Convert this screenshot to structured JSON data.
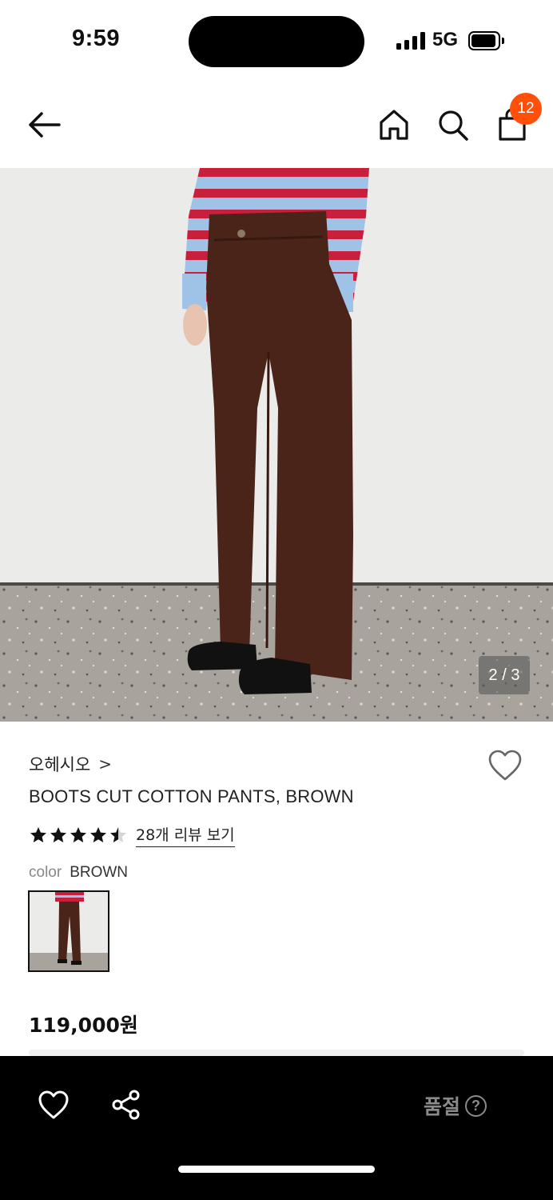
{
  "status_bar": {
    "time": "9:59",
    "network": "5G",
    "icons": [
      "signal-icon",
      "battery-icon"
    ]
  },
  "nav": {
    "icons": [
      "back-arrow-icon",
      "home-icon",
      "search-icon",
      "shopping-bag-icon"
    ],
    "cart_count": "12"
  },
  "gallery": {
    "counter": "2 / 3",
    "current": 2,
    "total": 3
  },
  "product": {
    "brand": "오헤시오",
    "brand_chevron": ">",
    "title": "BOOTS CUT COTTON PANTS, BROWN",
    "rating": 4.5,
    "review_link": "28개 리뷰 보기",
    "color_label": "color",
    "color_value": "BROWN",
    "price": "119,000원"
  },
  "bottom_bar": {
    "status_label": "품절",
    "help_glyph": "?",
    "icons": [
      "heart-icon",
      "share-icon",
      "help-icon"
    ]
  },
  "colors": {
    "badge": "#ff4f0a",
    "bottom_bar_bg": "#000000",
    "disabled_text": "#8a8a8a"
  }
}
